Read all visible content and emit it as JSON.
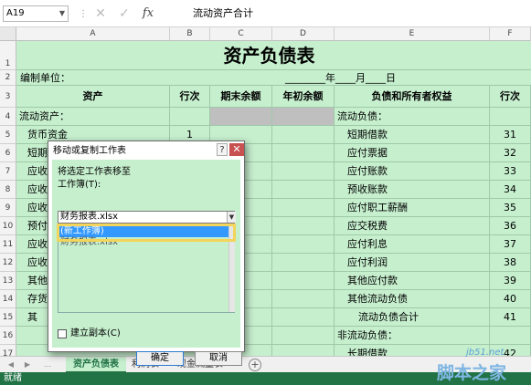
{
  "formula_bar": {
    "name_box": "A19",
    "cancel_icon": "x-icon",
    "confirm_icon": "check-icon",
    "fx_label": "fx",
    "content": "流动资产合计"
  },
  "columns": [
    "A",
    "B",
    "C",
    "D",
    "E",
    "F"
  ],
  "rows": [
    "1",
    "2",
    "3",
    "4",
    "5",
    "6",
    "7",
    "8",
    "9",
    "10",
    "11",
    "12",
    "13",
    "14",
    "15",
    "16",
    "17"
  ],
  "sheet": {
    "title": "资产负债表",
    "unit_label": "编制单位：",
    "date_line": "________年____月____日",
    "header": [
      "资产",
      "行次",
      "期末余额",
      "年初余额",
      "负债和所有者权益",
      "行次"
    ],
    "left_items": [
      "流动资产：",
      "货币资金",
      "短期",
      "应收",
      "应收",
      "应收",
      "预付",
      "应收",
      "应收",
      "其他",
      "存货",
      "其",
      "",
      ""
    ],
    "left_rownum": [
      "",
      "1",
      "",
      "",
      "",
      "",
      "",
      "",
      "",
      "",
      "",
      "",
      "",
      ""
    ],
    "right_items": [
      "流动负债：",
      "短期借款",
      "应付票据",
      "应付账款",
      "预收账款",
      "应付职工薪酬",
      "应交税费",
      "应付利息",
      "应付利润",
      "其他应付款",
      "其他流动负债",
      "流动负债合计",
      "非流动负债：",
      "长期借款"
    ],
    "right_rownum": [
      "",
      "31",
      "32",
      "33",
      "34",
      "35",
      "36",
      "37",
      "38",
      "39",
      "40",
      "41",
      "",
      "42"
    ]
  },
  "tabs": [
    "资产负债表",
    "利润表",
    "现金流量表"
  ],
  "status": "就绪",
  "dialog": {
    "title": "移动或复制工作表",
    "help": "?",
    "close": "✕",
    "move_label": "将选定工作表移至",
    "workbook_label": "工作簿(T):",
    "workbook_value": "财务报表.xlsx",
    "options": [
      "(新工作簿)",
      "财务报表.xlsx"
    ],
    "copy_label": "建立副本(C)",
    "ok": "确定",
    "cancel": "取消"
  },
  "watermark": {
    "site": "jb51.net",
    "text": "脚本之家"
  },
  "colors": {
    "excel_green": "#217346",
    "sheet_bg": "#c6efce",
    "highlight": "#f2d55a",
    "selection": "#3399ff"
  }
}
